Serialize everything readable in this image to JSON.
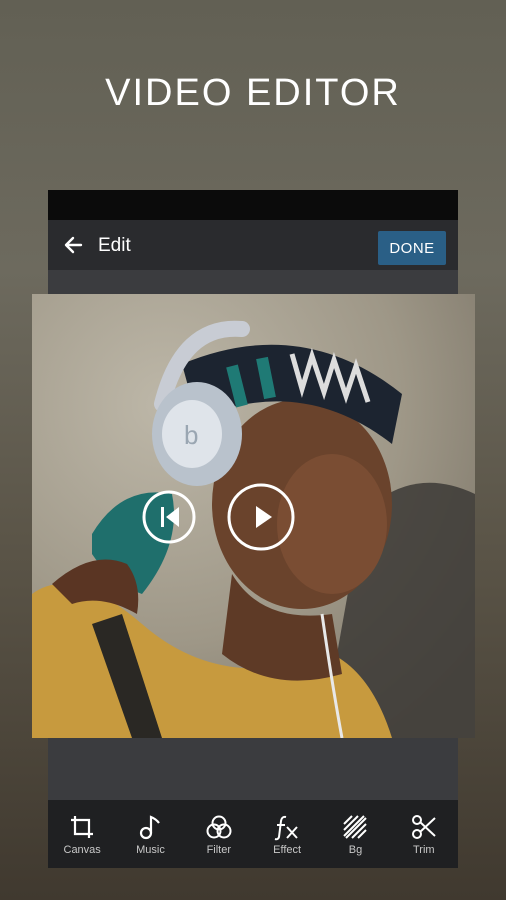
{
  "promo": {
    "headline": "VIDEO EDITOR"
  },
  "app_bar": {
    "title": "Edit",
    "done_label": "DONE"
  },
  "toolbar": {
    "items": [
      {
        "label": "Canvas",
        "icon": "crop-icon"
      },
      {
        "label": "Music",
        "icon": "music-note-icon"
      },
      {
        "label": "Filter",
        "icon": "filter-circles-icon"
      },
      {
        "label": "Effect",
        "icon": "fx-icon"
      },
      {
        "label": "Bg",
        "icon": "hatched-background-icon"
      },
      {
        "label": "Trim",
        "icon": "scissors-icon"
      }
    ]
  },
  "player": {
    "controls": [
      "previous-frame-icon",
      "play-icon"
    ]
  },
  "colors": {
    "accent": "#2a5f86",
    "toolbar_bg": "#1f2022",
    "appbar_bg": "#2a2b2e"
  }
}
